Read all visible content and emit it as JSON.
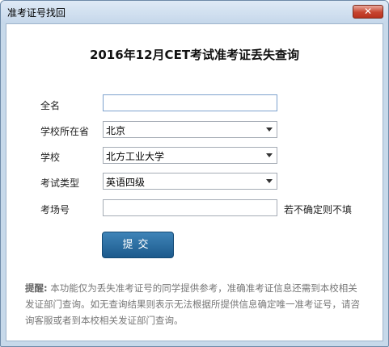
{
  "window": {
    "title": "准考证号找回",
    "close_label": "✕"
  },
  "heading": "2016年12月CET考试准考证丢失查询",
  "form": {
    "name_label": "全名",
    "name_value": "",
    "province_label": "学校所在省",
    "province_value": "北京",
    "school_label": "学校",
    "school_value": "北方工业大学",
    "exam_type_label": "考试类型",
    "exam_type_value": "英语四级",
    "room_label": "考场号",
    "room_value": "",
    "room_hint": "若不确定则不填",
    "submit_label": "提交"
  },
  "note": {
    "title": "提醒:",
    "body": "本功能仅为丢失准考证号的同学提供参考，准确准考证信息还需到本校相关发证部门查询。如无查询结果则表示无法根据所提供信息确定唯一准考证号，请咨询客服或者到本校相关发证部门查询。"
  }
}
